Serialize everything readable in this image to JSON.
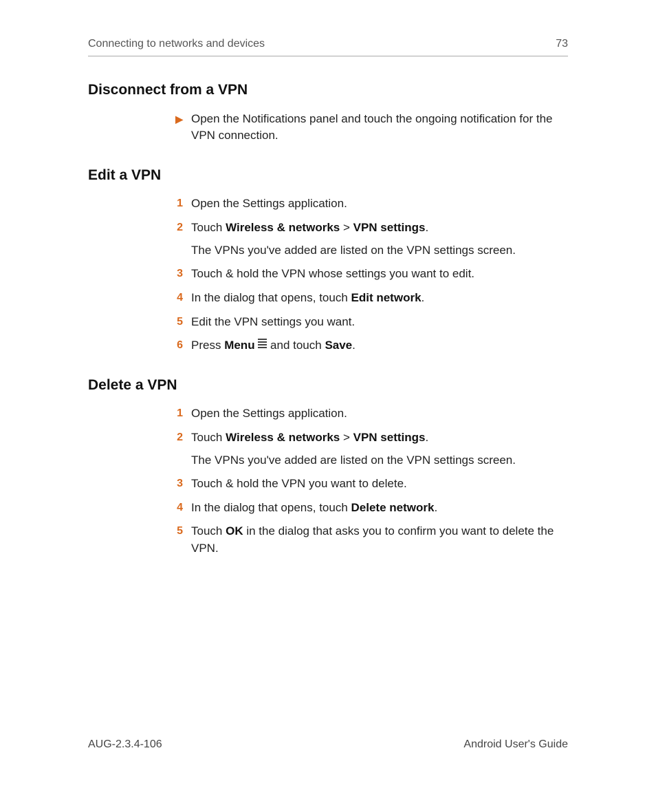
{
  "header": {
    "chapter": "Connecting to networks and devices",
    "page_number": "73"
  },
  "sections": {
    "s1": {
      "title": "Disconnect from a VPN",
      "bullet_text": "Open the Notifications panel and touch the ongoing notification for the VPN connection."
    },
    "s2": {
      "title": "Edit a VPN",
      "step1": "Open the Settings application.",
      "step2_pre": "Touch ",
      "step2_b1": "Wireless & networks",
      "step2_sep": " > ",
      "step2_b2": "VPN settings",
      "step2_post": ".",
      "step2_sub": "The VPNs you've added are listed on the VPN settings screen.",
      "step3": "Touch & hold the VPN whose settings you want to edit.",
      "step4_pre": "In the dialog that opens, touch ",
      "step4_b": "Edit network",
      "step4_post": ".",
      "step5": "Edit the VPN settings you want.",
      "step6_pre": "Press ",
      "step6_b1": "Menu",
      "step6_mid": " and touch ",
      "step6_b2": "Save",
      "step6_post": "."
    },
    "s3": {
      "title": "Delete a VPN",
      "step1": "Open the Settings application.",
      "step2_pre": "Touch ",
      "step2_b1": "Wireless & networks",
      "step2_sep": " > ",
      "step2_b2": "VPN settings",
      "step2_post": ".",
      "step2_sub": "The VPNs you've added are listed on the VPN settings screen.",
      "step3": "Touch & hold the VPN you want to delete.",
      "step4_pre": "In the dialog that opens, touch ",
      "step4_b": "Delete network",
      "step4_post": ".",
      "step5_pre": "Touch ",
      "step5_b": "OK",
      "step5_post": " in the dialog that asks you to confirm you want to delete the VPN."
    }
  },
  "footer": {
    "left": "AUG-2.3.4-106",
    "right": "Android User's Guide"
  },
  "markers": {
    "tri": "▶",
    "n1": "1",
    "n2": "2",
    "n3": "3",
    "n4": "4",
    "n5": "5",
    "n6": "6"
  }
}
